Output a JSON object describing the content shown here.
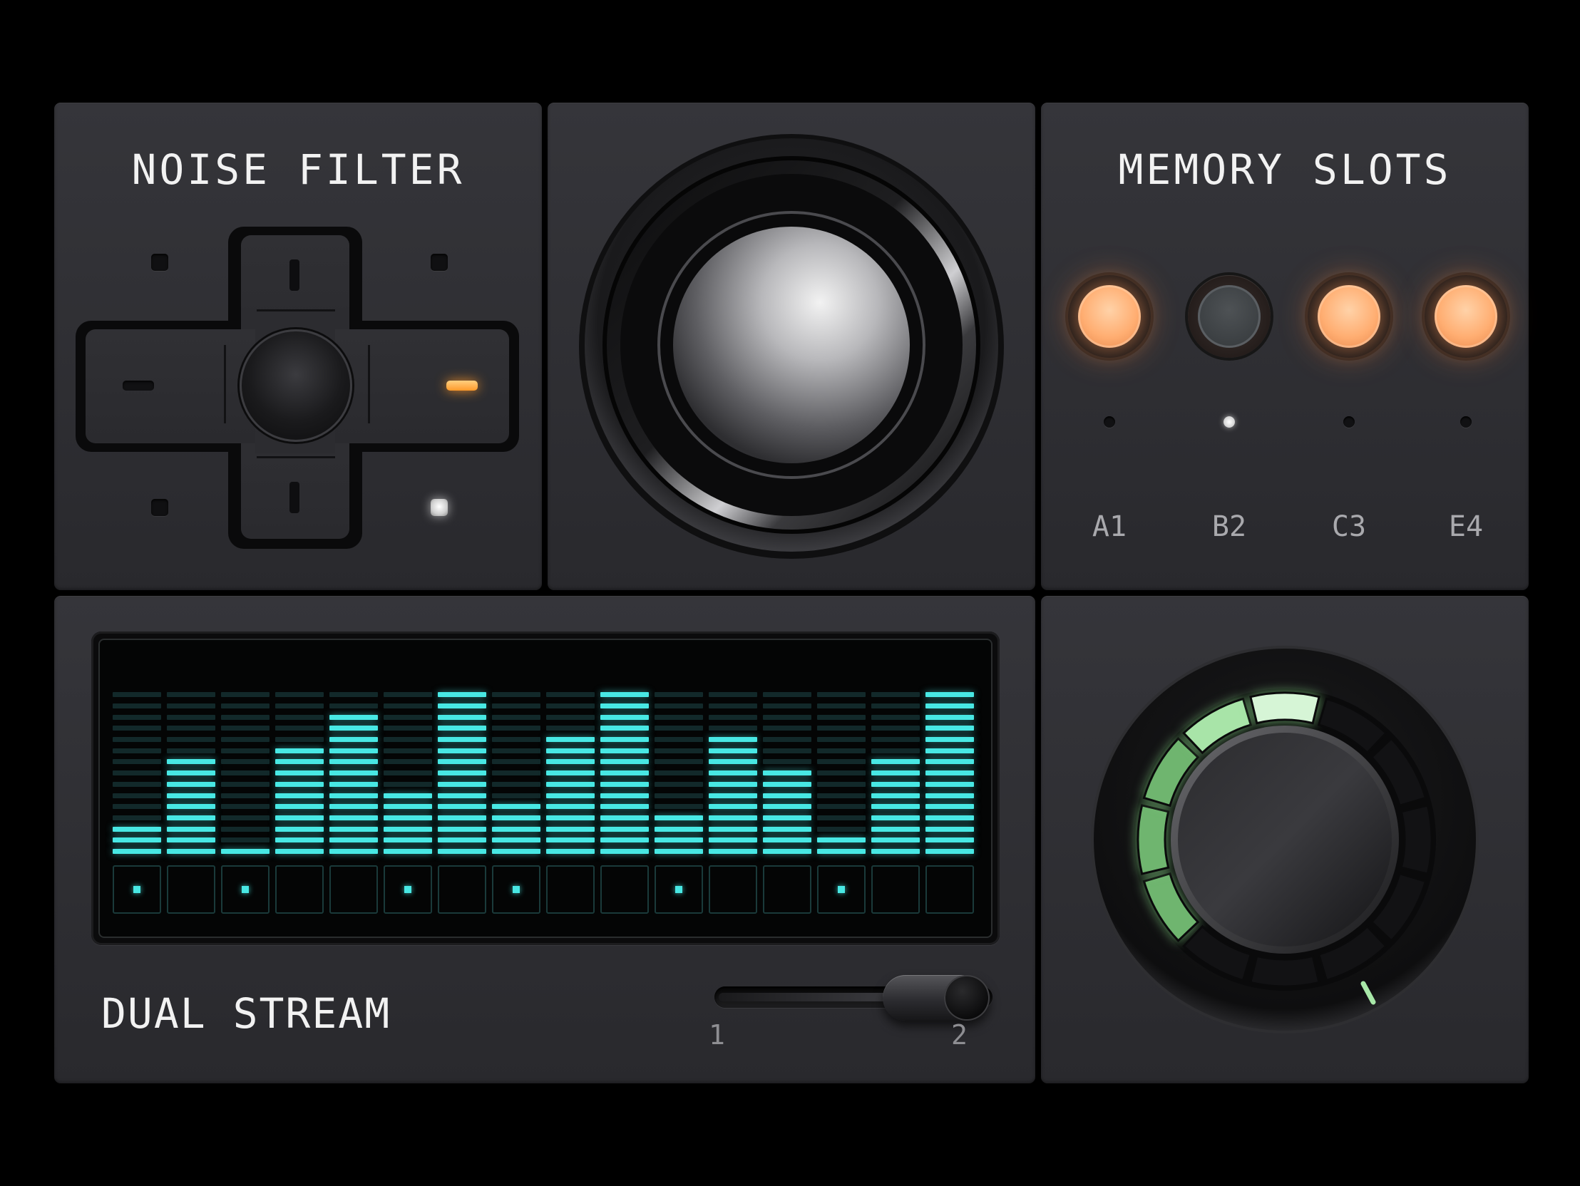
{
  "noise_filter": {
    "title": "NOISE FILTER",
    "left_indicator": "off",
    "right_indicator": "on",
    "bottom_right_led": "on"
  },
  "memory_slots": {
    "title": "MEMORY SLOTS",
    "slots": [
      {
        "label": "A1",
        "lit": true,
        "selected": false
      },
      {
        "label": "B2",
        "lit": false,
        "selected": true
      },
      {
        "label": "C3",
        "lit": true,
        "selected": false
      },
      {
        "label": "E4",
        "lit": true,
        "selected": false
      }
    ]
  },
  "spectrum": {
    "segments_per_bar": 15,
    "levels": [
      3,
      9,
      1,
      10,
      13,
      6,
      15,
      5,
      11,
      15,
      4,
      11,
      8,
      2,
      9,
      15
    ],
    "steps_active": [
      true,
      false,
      true,
      false,
      false,
      true,
      false,
      true,
      false,
      false,
      true,
      false,
      false,
      true,
      false,
      false
    ],
    "accent": "#48e8e4"
  },
  "dual_stream": {
    "label": "DUAL STREAM",
    "min_label": "1",
    "max_label": "2",
    "value_fraction": 1.0
  },
  "dial": {
    "segments_total": 12,
    "segments_lit": 5,
    "accent": "#8fd88f"
  },
  "colors": {
    "amber": "#ff9a2a",
    "slot_orange": "#ffae72",
    "cyan": "#48e8e4",
    "green": "#8fd88f"
  }
}
